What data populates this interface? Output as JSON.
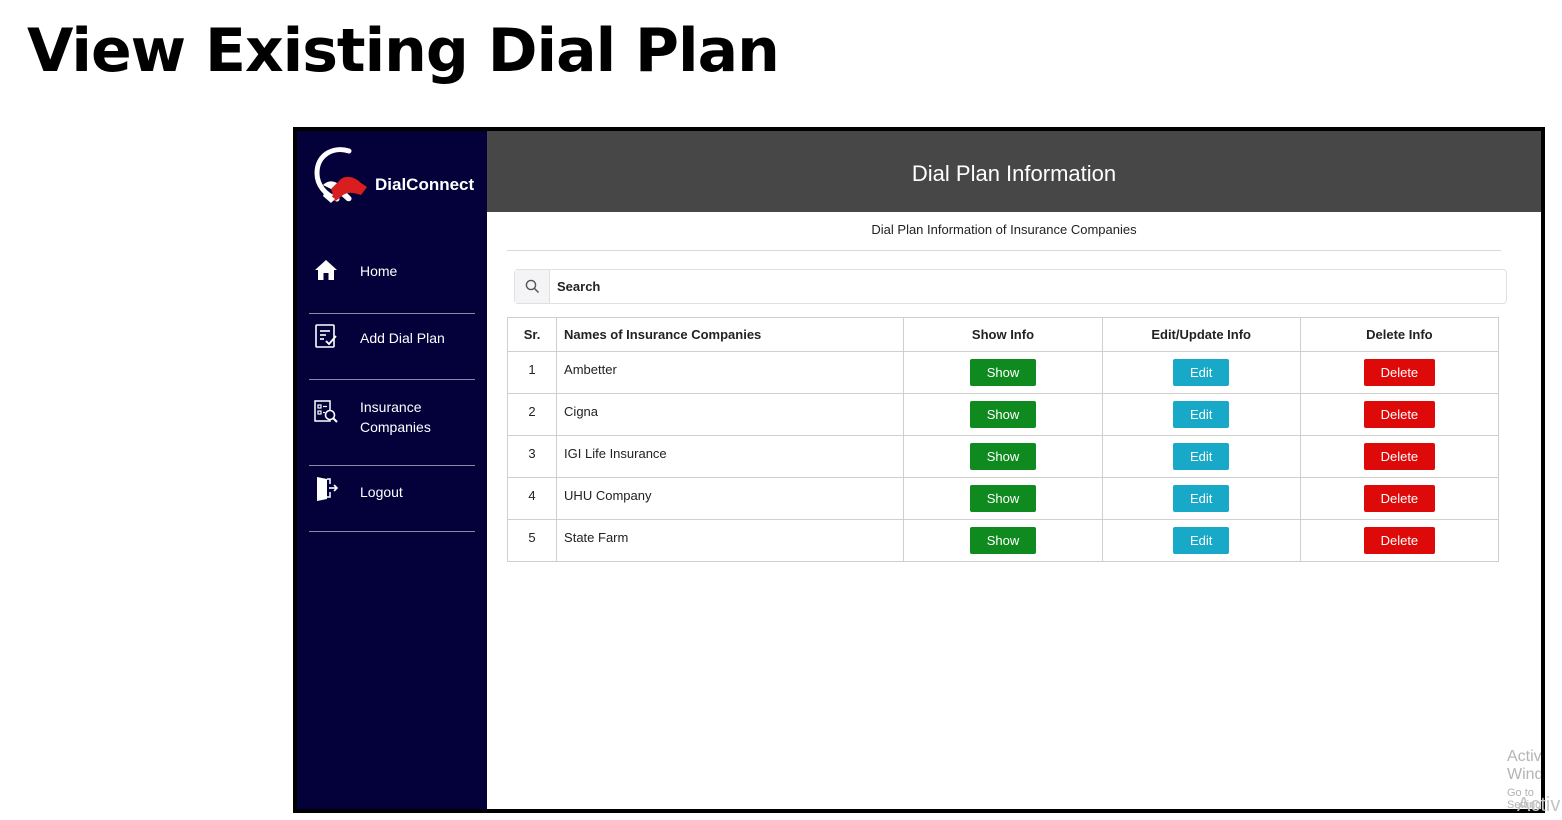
{
  "page_heading": "View Existing Dial Plan",
  "brand": {
    "name": "DialConnect",
    "logo_icon": "handshake-logo-icon"
  },
  "sidebar": {
    "items": [
      {
        "label": "Home",
        "icon": "home-icon"
      },
      {
        "label": "Add Dial Plan",
        "icon": "add-list-icon"
      },
      {
        "label_line1": "Insurance",
        "label_line2": "Companies",
        "icon": "companies-search-icon"
      },
      {
        "label": "Logout",
        "icon": "logout-icon"
      }
    ]
  },
  "header": {
    "title": "Dial Plan Information"
  },
  "subheading": "Dial Plan Information of Insurance Companies",
  "search": {
    "placeholder": "Search",
    "icon": "search-icon"
  },
  "table": {
    "headers": [
      "Sr.",
      "Names of Insurance Companies",
      "Show Info",
      "Edit/Update Info",
      "Delete Info"
    ],
    "rows": [
      {
        "sr": "1",
        "name": "Ambetter",
        "show": "Show",
        "edit": "Edit",
        "delete": "Delete"
      },
      {
        "sr": "2",
        "name": "Cigna",
        "show": "Show",
        "edit": "Edit",
        "delete": "Delete"
      },
      {
        "sr": "3",
        "name": "IGI Life Insurance",
        "show": "Show",
        "edit": "Edit",
        "delete": "Delete"
      },
      {
        "sr": "4",
        "name": "UHU Company",
        "show": "Show",
        "edit": "Edit",
        "delete": "Delete"
      },
      {
        "sr": "5",
        "name": "State Farm",
        "show": "Show",
        "edit": "Edit",
        "delete": "Delete"
      }
    ]
  },
  "watermark": {
    "title": "Activate Windows",
    "subtitle": "Go to Settings to activate Windows.",
    "edge": "Activ"
  },
  "colors": {
    "sidebar_bg": "#03003a",
    "header_bg": "#474747",
    "show_button": "#0f8a1f",
    "edit_button": "#17a9c7",
    "delete_button": "#de0a0a",
    "logo_red": "#d81e1e"
  }
}
